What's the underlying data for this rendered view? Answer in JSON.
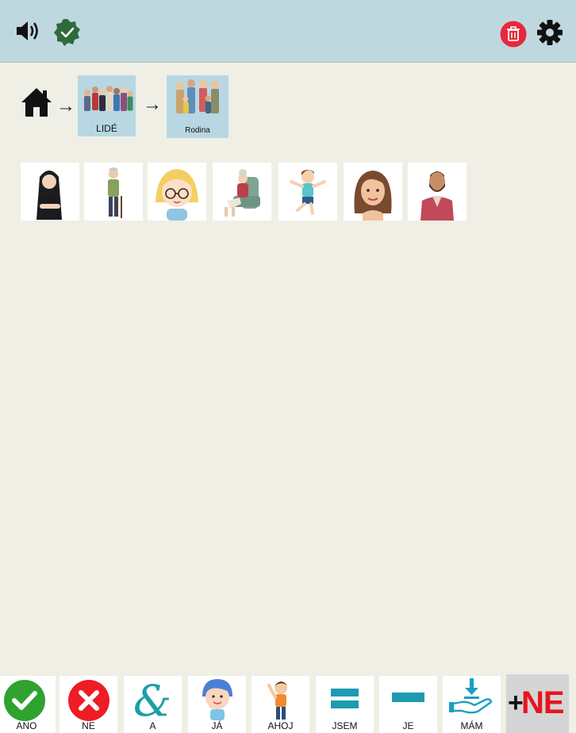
{
  "header": {
    "speaker_icon": "speaker-icon",
    "check_icon": "check-badge-icon",
    "trash_icon": "trash-icon",
    "settings_icon": "gear-icon",
    "colors": {
      "bar": "#bfd8df",
      "check": "#2e6b3a",
      "trash": "#e8283c"
    }
  },
  "breadcrumb": {
    "home_icon": "home-icon",
    "arrow": "→",
    "items": [
      {
        "label": "LIDÉ",
        "image": "group-of-people"
      },
      {
        "label": "Rodina",
        "image": "family"
      }
    ]
  },
  "people": [
    {
      "image": "woman-with-dark-hair-arms-crossed"
    },
    {
      "image": "elderly-man-with-cane"
    },
    {
      "image": "blonde-girl-with-glasses"
    },
    {
      "image": "grandmother-in-armchair"
    },
    {
      "image": "jumping-boy"
    },
    {
      "image": "brown-haired-woman"
    },
    {
      "image": "bearded-man"
    }
  ],
  "bottom_bar": {
    "tiles": [
      {
        "label": "ANO",
        "icon": "check-circle-icon"
      },
      {
        "label": "NE",
        "icon": "x-circle-icon"
      },
      {
        "label": "A",
        "icon": "ampersand-icon"
      },
      {
        "label": "JÁ",
        "icon": "child-pointing-self-icon"
      },
      {
        "label": "AHOJ",
        "icon": "boy-waving-icon"
      },
      {
        "label": "JSEM",
        "icon": "equals-icon"
      },
      {
        "label": "JE",
        "icon": "minus-icon"
      },
      {
        "label": "MÁM",
        "icon": "hand-receiving-icon"
      }
    ],
    "plus_ne": {
      "plus": "+",
      "ne": "NE"
    }
  }
}
